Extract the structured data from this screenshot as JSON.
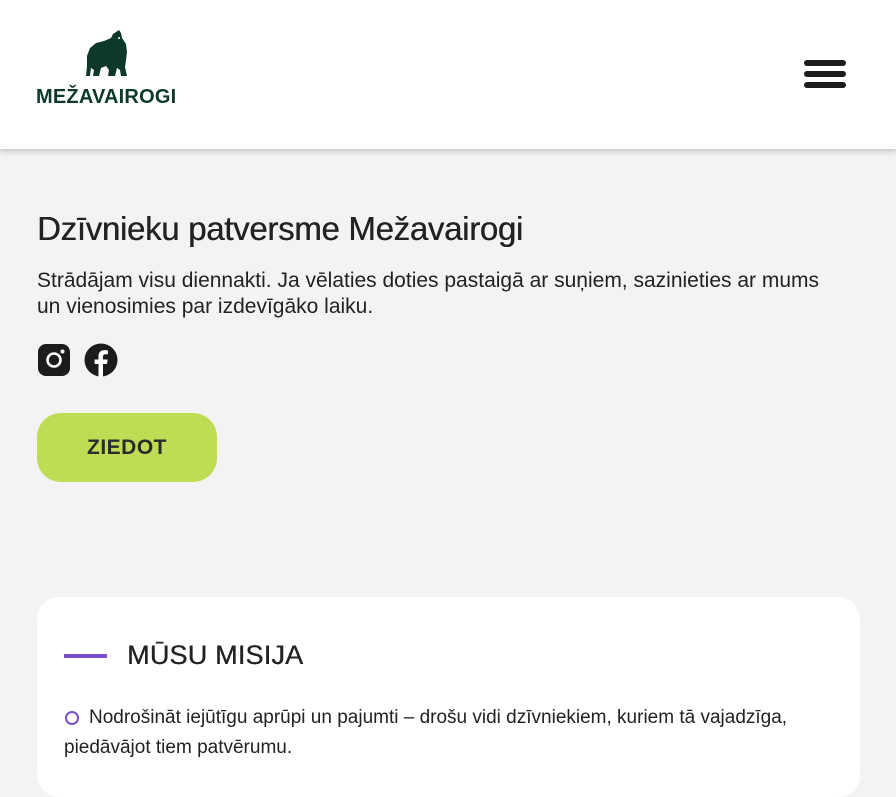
{
  "header": {
    "logo_text": "MEŽAVAIROGI",
    "logo_color": "#0d3a28",
    "menu_icon": "hamburger-menu-icon"
  },
  "hero": {
    "title": "Dzīvnieku patversme Mežavairogi",
    "description": "Strādājam visu diennakti. Ja vēlaties doties pastaigā ar suņiem, sazinieties ar mums un vienosimies par izdevīgāko laiku.",
    "social_icons": [
      "instagram-icon",
      "facebook-icon"
    ],
    "donate_label": "ZIEDOT",
    "donate_color": "#bfdc55"
  },
  "mission": {
    "title": "MŪSU MISIJA",
    "accent_color": "#7b4fd0",
    "items": [
      "Nodrošināt iejūtīgu aprūpi un pajumti – drošu vidi dzīvniekiem, kuriem tā vajadzīga, piedāvājot tiem patvērumu."
    ]
  }
}
